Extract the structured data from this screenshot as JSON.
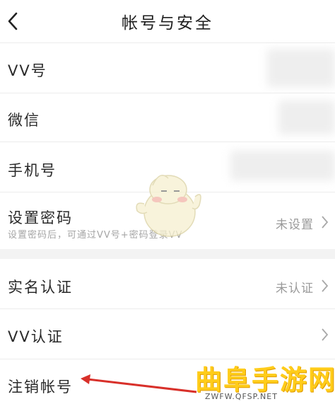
{
  "header": {
    "title": "帐号与安全",
    "back_icon": "chevron-left-icon"
  },
  "rows": [
    {
      "label": "VV号"
    },
    {
      "label": "微信"
    },
    {
      "label": "手机号"
    },
    {
      "label": "设置密码",
      "value": "未设置",
      "hint": "设置密码后，可通过VV号+密码登录VV"
    }
  ],
  "rows2": [
    {
      "label": "实名认证",
      "value": "未认证"
    },
    {
      "label": "VV认证"
    },
    {
      "label": "注销帐号"
    }
  ],
  "watermark": {
    "title": "曲阜手游网",
    "url": "ZWFW.QFSP.NET"
  },
  "colors": {
    "divider": "#ececec",
    "gap": "#f3f3f3",
    "arrow": "#d8302a",
    "watermark": "#ffcc1a"
  }
}
